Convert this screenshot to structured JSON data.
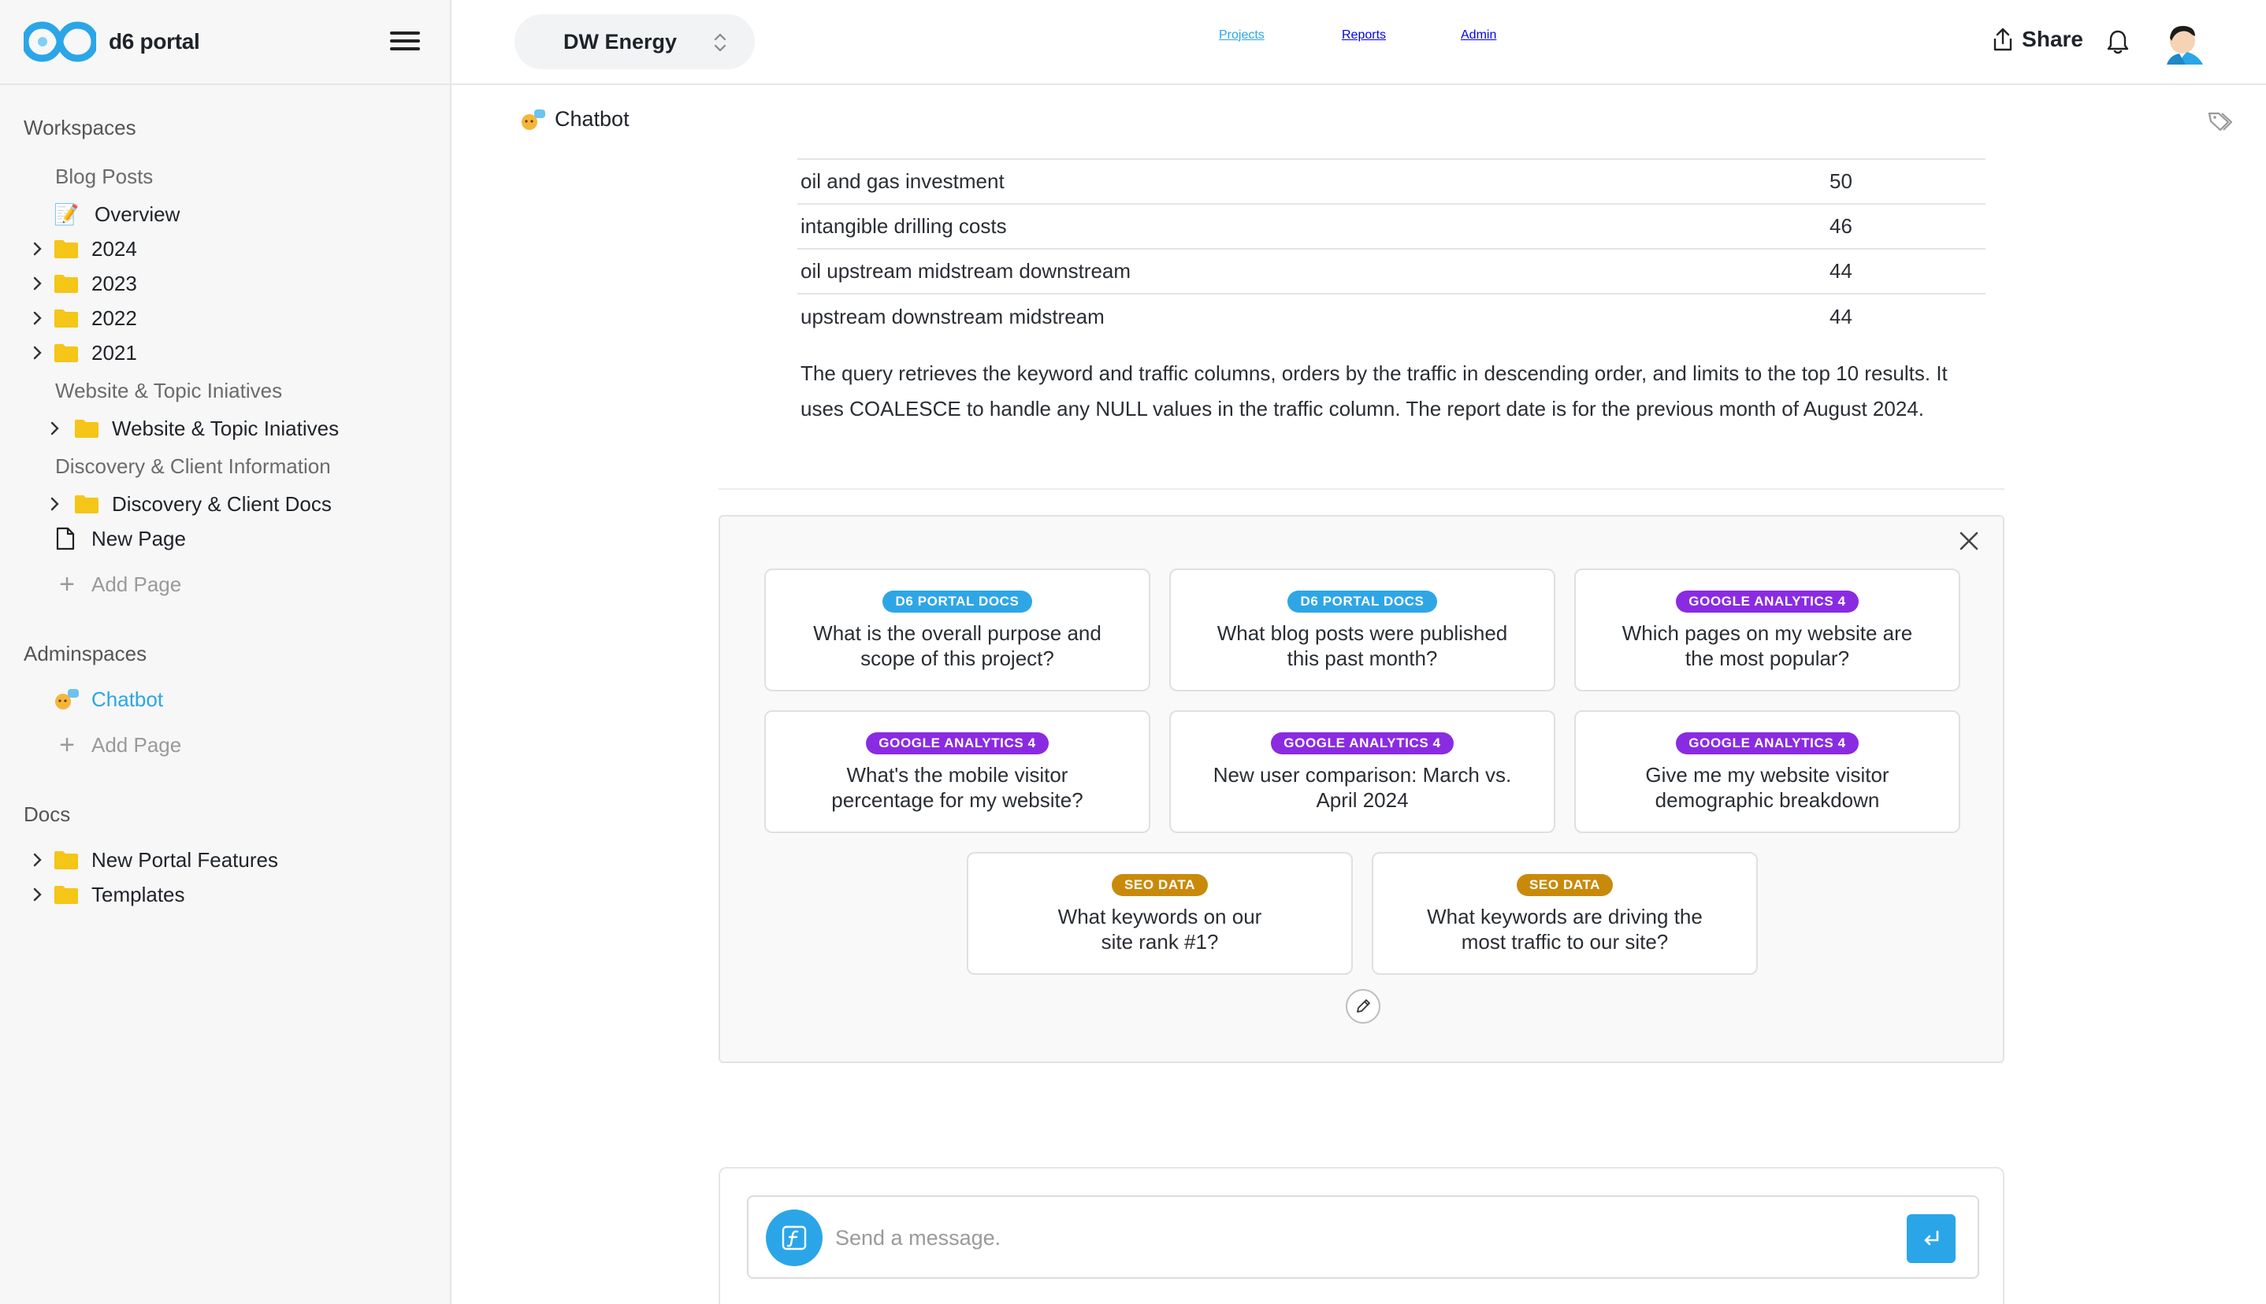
{
  "app": {
    "logo_text": "d6 portal"
  },
  "sidebar": {
    "workspaces_title": "Workspaces",
    "blog_posts_label": "Blog Posts",
    "overview": {
      "emoji": "📝",
      "label": "Overview"
    },
    "years": [
      "2024",
      "2023",
      "2022",
      "2021"
    ],
    "website_section_label": "Website & Topic Iniatives",
    "website_folder_label": "Website & Topic Iniatives",
    "discovery_section_label": "Discovery & Client Information",
    "discovery_folder_label": "Discovery & Client Docs",
    "new_page_label": "New Page",
    "add_page_label": "Add Page",
    "adminspaces_title": "Adminspaces",
    "chatbot_label": "Chatbot",
    "add_page_label_2": "Add Page",
    "docs_title": "Docs",
    "docs_folders": [
      "New Portal Features",
      "Templates"
    ]
  },
  "topbar": {
    "workspace": "DW Energy",
    "nav": {
      "projects": "Projects",
      "reports": "Reports",
      "admin": "Admin"
    },
    "share_label": "Share"
  },
  "content": {
    "breadcrumb": "Chatbot",
    "table_rows": [
      {
        "keyword": "oil and gas investment",
        "traffic": "50"
      },
      {
        "keyword": "intangible drilling costs",
        "traffic": "46"
      },
      {
        "keyword": "oil upstream midstream downstream",
        "traffic": "44"
      },
      {
        "keyword": "upstream downstream midstream",
        "traffic": "44"
      }
    ],
    "summary": "The query retrieves the keyword and traffic columns, orders by the traffic in descending order, and limits to the top 10 results. It uses COALESCE to handle any NULL values in the traffic column. The report date is for the previous month of August 2024."
  },
  "suggestions": [
    {
      "badge": "D6 PORTAL DOCS",
      "question": "What is the overall purpose and scope of this project?"
    },
    {
      "badge": "D6 PORTAL DOCS",
      "question": "What blog posts were published this past month?"
    },
    {
      "badge": "GOOGLE ANALYTICS 4",
      "question": "Which pages on my website are the most popular?"
    },
    {
      "badge": "GOOGLE ANALYTICS 4",
      "question": "What's the mobile visitor percentage for my website?"
    },
    {
      "badge": "GOOGLE ANALYTICS 4",
      "question": "New user comparison: March vs. April 2024"
    },
    {
      "badge": "GOOGLE ANALYTICS 4",
      "question": "Give me my website visitor demographic breakdown"
    },
    {
      "badge": "SEO DATA",
      "question": "What keywords on our site rank #1?"
    },
    {
      "badge": "SEO DATA",
      "question": "What keywords are driving the most traffic to our site?"
    }
  ],
  "composer": {
    "placeholder": "Send a message."
  },
  "colors": {
    "accent": "#2aa6e8",
    "badge_docs": "#2ea6e6",
    "badge_ga4": "#8a2be2",
    "badge_seo": "#c98a0c",
    "folder": "#f5c518"
  },
  "icons": {
    "menu": "hamburger-icon",
    "close": "close-icon",
    "edit": "pencil-icon",
    "send": "enter-icon",
    "function": "function-icon",
    "share": "share-icon",
    "bell": "bell-icon",
    "tag": "tag-icon"
  }
}
